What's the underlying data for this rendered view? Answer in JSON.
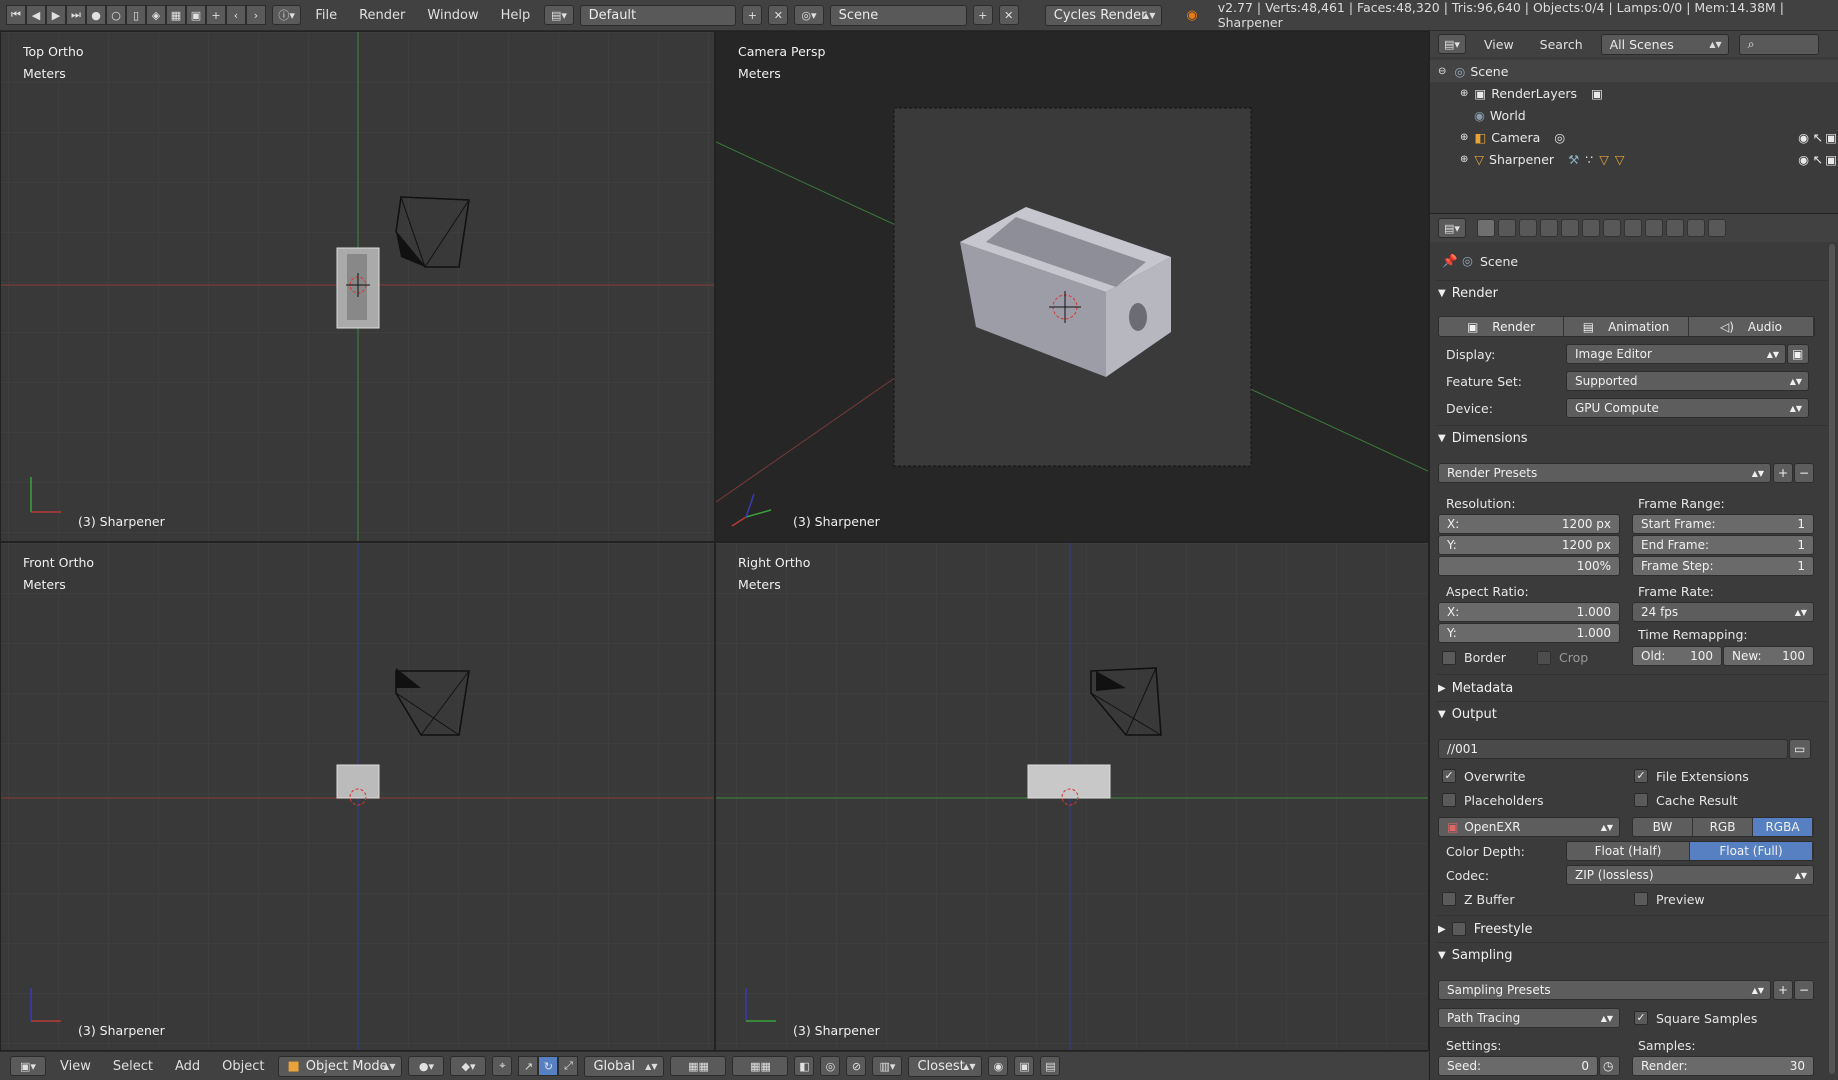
{
  "topbar": {
    "menus": [
      "File",
      "Render",
      "Window",
      "Help"
    ],
    "layout": "Default",
    "scene": "Scene",
    "engine": "Cycles Render",
    "stats": "v2.77 | Verts:48,461 | Faces:48,320 | Tris:96,640 | Objects:0/4 | Lamps:0/0 | Mem:14.38M | Sharpener"
  },
  "viewports": {
    "top": {
      "title": "Top Ortho",
      "units": "Meters",
      "object": "(3) Sharpener"
    },
    "camera": {
      "title": "Camera Persp",
      "units": "Meters",
      "object": "(3) Sharpener"
    },
    "front": {
      "title": "Front Ortho",
      "units": "Meters",
      "object": "(3) Sharpener"
    },
    "right": {
      "title": "Right Ortho",
      "units": "Meters",
      "object": "(3) Sharpener"
    }
  },
  "bottombar": {
    "menus": [
      "View",
      "Select",
      "Add",
      "Object"
    ],
    "mode": "Object Mode",
    "orientation": "Global",
    "snap": "Closest"
  },
  "outliner": {
    "view": "View",
    "search": "Search",
    "filter": "All Scenes",
    "items": [
      {
        "label": "Scene",
        "indent": 0
      },
      {
        "label": "RenderLayers",
        "indent": 1
      },
      {
        "label": "World",
        "indent": 1
      },
      {
        "label": "Camera",
        "indent": 1
      },
      {
        "label": "Sharpener",
        "indent": 1
      }
    ]
  },
  "properties": {
    "context": "Scene",
    "render": {
      "title": "Render",
      "buttons": [
        "Render",
        "Animation",
        "Audio"
      ],
      "display_label": "Display:",
      "display": "Image Editor",
      "feature_label": "Feature Set:",
      "feature": "Supported",
      "device_label": "Device:",
      "device": "GPU Compute"
    },
    "dimensions": {
      "title": "Dimensions",
      "presets": "Render Presets",
      "resolution_label": "Resolution:",
      "res_x_label": "X:",
      "res_x": "1200 px",
      "res_y_label": "Y:",
      "res_y": "1200 px",
      "res_pct": "100%",
      "frame_range_label": "Frame Range:",
      "start_label": "Start Frame:",
      "start": "1",
      "end_label": "End Frame:",
      "end": "1",
      "step_label": "Frame Step:",
      "step": "1",
      "aspect_label": "Aspect Ratio:",
      "asp_x_label": "X:",
      "asp_x": "1.000",
      "asp_y_label": "Y:",
      "asp_y": "1.000",
      "frame_rate_label": "Frame Rate:",
      "frame_rate": "24 fps",
      "time_remap_label": "Time Remapping:",
      "old_label": "Old:",
      "old": "100",
      "new_label": "New:",
      "new": "100",
      "border": "Border",
      "crop": "Crop"
    },
    "metadata": {
      "title": "Metadata"
    },
    "output": {
      "title": "Output",
      "path": "//001",
      "overwrite": "Overwrite",
      "file_ext": "File Extensions",
      "placeholders": "Placeholders",
      "cache": "Cache Result",
      "format": "OpenEXR",
      "channels": [
        "BW",
        "RGB",
        "RGBA"
      ],
      "color_depth_label": "Color Depth:",
      "depths": [
        "Float (Half)",
        "Float (Full)"
      ],
      "codec_label": "Codec:",
      "codec": "ZIP (lossless)",
      "zbuffer": "Z Buffer",
      "preview": "Preview"
    },
    "freestyle": {
      "title": "Freestyle"
    },
    "sampling": {
      "title": "Sampling",
      "presets": "Sampling Presets",
      "method": "Path Tracing",
      "square": "Square Samples",
      "settings_label": "Settings:",
      "samples_label": "Samples:",
      "seed_label": "Seed:",
      "seed": "0",
      "render_label": "Render:",
      "render": "30"
    }
  },
  "colors": {
    "accent": "#5680c2",
    "x_axis": "#b53a3a",
    "y_axis": "#3aa33a",
    "z_axis": "#3a3ab5"
  }
}
